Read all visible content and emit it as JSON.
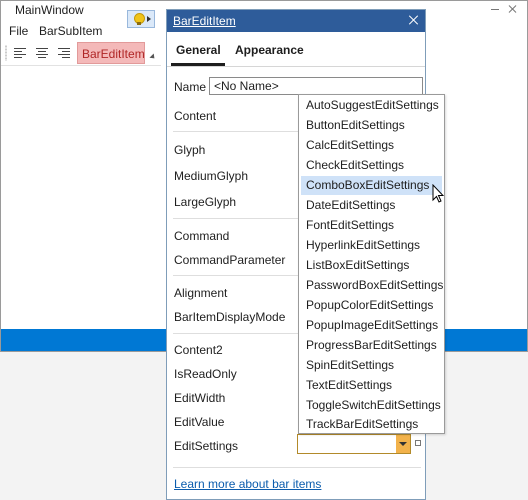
{
  "window": {
    "title": "MainWindow",
    "menu": [
      "File",
      "BarSubItem"
    ],
    "toolbar": {
      "align_buttons": [
        "align-left-icon",
        "align-center-icon",
        "align-right-icon"
      ],
      "bar_edit_item": "BarEditItem"
    }
  },
  "panel": {
    "title": "BarEditItem",
    "tabs": [
      "General",
      "Appearance"
    ],
    "active_tab": "General",
    "name_label": "Name",
    "name_value": "<No Name>",
    "properties": {
      "content": "Content",
      "glyph": "Glyph",
      "medium_glyph": "MediumGlyph",
      "large_glyph": "LargeGlyph",
      "command": "Command",
      "command_parameter": "CommandParameter",
      "alignment": "Alignment",
      "bar_item_display_mode": "BarItemDisplayMode",
      "content2": "Content2",
      "is_read_only": "IsReadOnly",
      "edit_width": "EditWidth",
      "edit_value": "EditValue",
      "edit_settings": "EditSettings"
    },
    "edit_settings_value": "",
    "learn_more": "Learn more about bar items"
  },
  "dropdown": {
    "items": [
      "AutoSuggestEditSettings",
      "ButtonEditSettings",
      "CalcEditSettings",
      "CheckEditSettings",
      "ComboBoxEditSettings",
      "DateEditSettings",
      "FontEditSettings",
      "HyperlinkEditSettings",
      "ListBoxEditSettings",
      "PasswordBoxEditSettings",
      "PopupColorEditSettings",
      "PopupImageEditSettings",
      "ProgressBarEditSettings",
      "SpinEditSettings",
      "TextEditSettings",
      "ToggleSwitchEditSettings",
      "TrackBarEditSettings"
    ],
    "hovered": "ComboBoxEditSettings"
  },
  "colors": {
    "panel_header": "#2e5c9a",
    "status_bar": "#0078d4",
    "bar_edit_item_bg": "#f4b9b9",
    "bar_edit_item_text": "#b02626",
    "hover_highlight": "#cfe2f8",
    "link": "#0b5cad"
  }
}
